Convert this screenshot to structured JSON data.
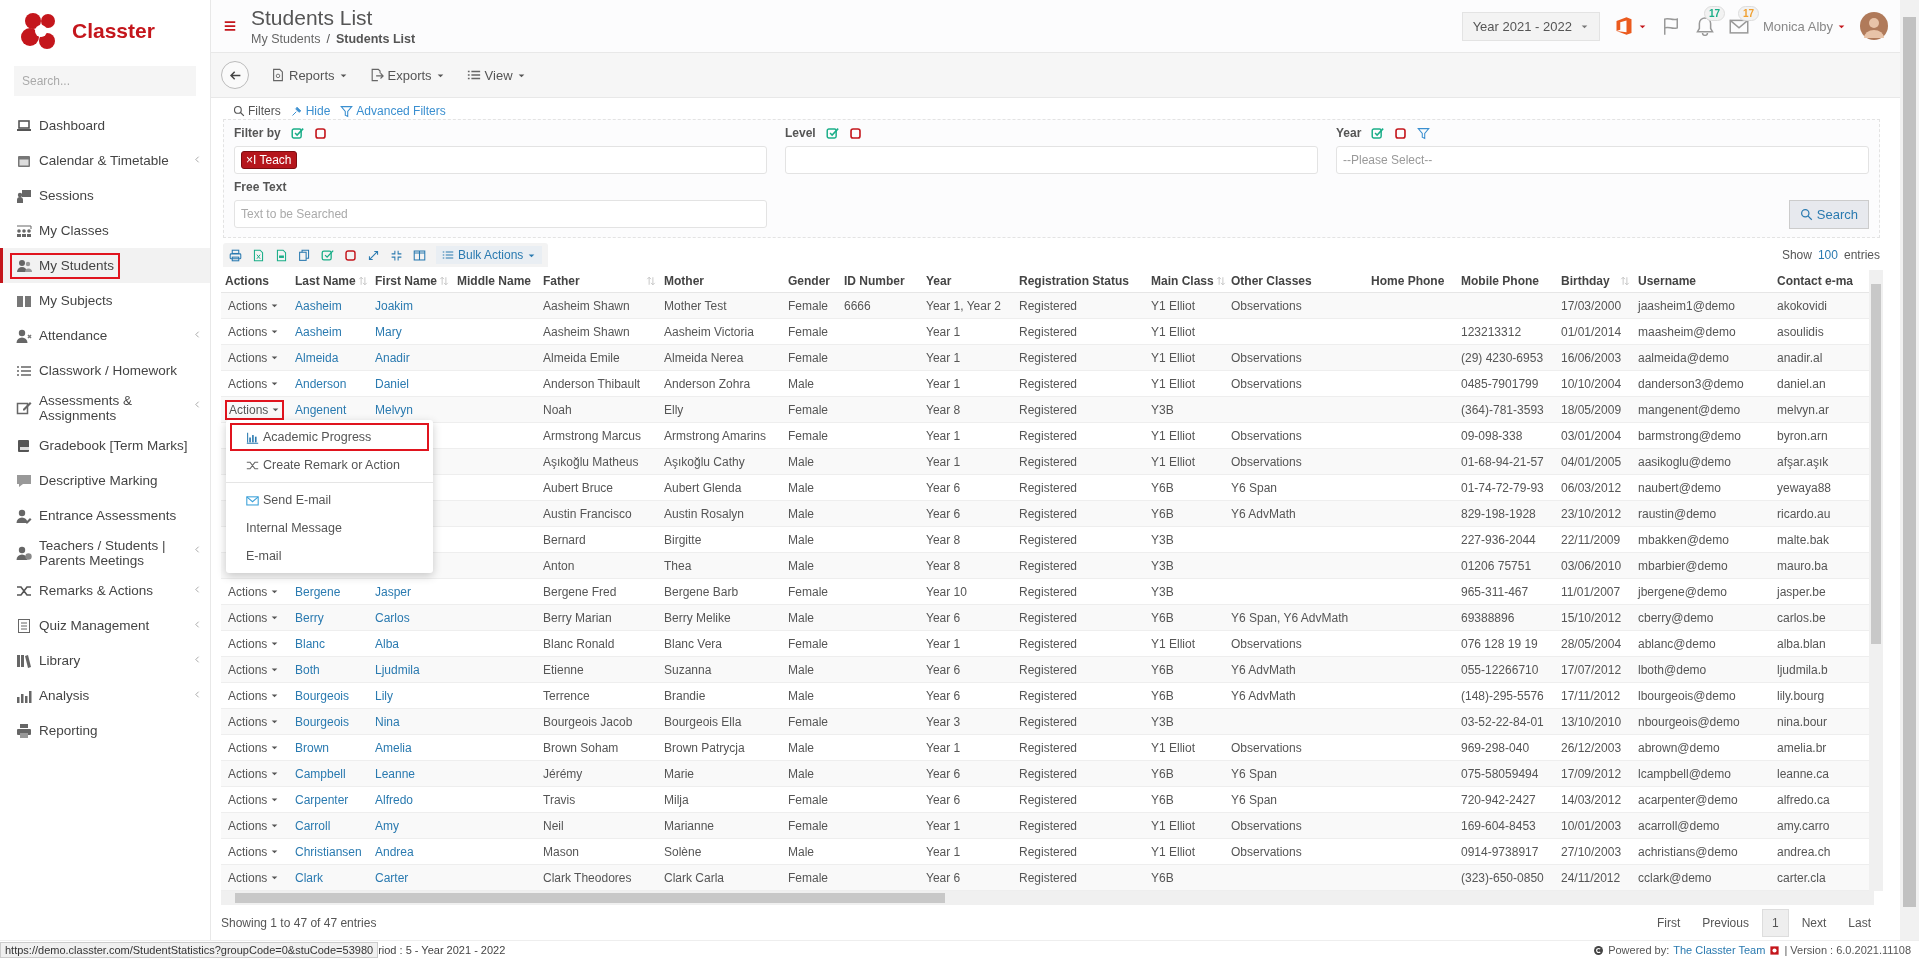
{
  "app": {
    "logo_text": "Classter"
  },
  "sidebar": {
    "search_placeholder": "Search...",
    "items": [
      {
        "label": "Dashboard",
        "selected": false,
        "outlined": false,
        "expandable": false
      },
      {
        "label": "Calendar & Timetable",
        "selected": false,
        "outlined": false,
        "expandable": true
      },
      {
        "label": "Sessions",
        "selected": false,
        "outlined": false,
        "expandable": false
      },
      {
        "label": "My Classes",
        "selected": false,
        "outlined": false,
        "expandable": false
      },
      {
        "label": "My Students",
        "selected": true,
        "outlined": true,
        "expandable": false
      },
      {
        "label": "My Subjects",
        "selected": false,
        "outlined": false,
        "expandable": false
      },
      {
        "label": "Attendance",
        "selected": false,
        "outlined": false,
        "expandable": true
      },
      {
        "label": "Classwork / Homework",
        "selected": false,
        "outlined": false,
        "expandable": false
      },
      {
        "label": "Assessments & Assignments",
        "selected": false,
        "outlined": false,
        "expandable": true
      },
      {
        "label": "Gradebook [Term Marks]",
        "selected": false,
        "outlined": false,
        "expandable": false
      },
      {
        "label": "Descriptive Marking",
        "selected": false,
        "outlined": false,
        "expandable": false
      },
      {
        "label": "Entrance Assessments",
        "selected": false,
        "outlined": false,
        "expandable": false
      },
      {
        "label": "Teachers / Students | Parents Meetings",
        "selected": false,
        "outlined": false,
        "expandable": true
      },
      {
        "label": "Remarks & Actions",
        "selected": false,
        "outlined": false,
        "expandable": true
      },
      {
        "label": "Quiz Management",
        "selected": false,
        "outlined": false,
        "expandable": true
      },
      {
        "label": "Library",
        "selected": false,
        "outlined": false,
        "expandable": true
      },
      {
        "label": "Analysis",
        "selected": false,
        "outlined": false,
        "expandable": true
      },
      {
        "label": "Reporting",
        "selected": false,
        "outlined": false,
        "expandable": false
      }
    ]
  },
  "header": {
    "title": "Students List",
    "breadcrumb": [
      {
        "label": "My Students",
        "current": false
      },
      {
        "label": "Students List",
        "current": true
      }
    ],
    "separator": "/",
    "year_select": "Year 2021 - 2022",
    "badges": [
      {
        "count": "17",
        "color": "#1aae88"
      },
      {
        "count": "17",
        "color": "#f0a030"
      }
    ],
    "user": "Monica Alby"
  },
  "toolbar": {
    "menus": [
      "Reports",
      "Exports",
      "View"
    ]
  },
  "filters": {
    "title": "Filters",
    "hide": "Hide",
    "advanced": "Advanced Filters",
    "filter_by": {
      "label": "Filter by",
      "tags": [
        {
          "remove": "×",
          "label": "I Teach"
        }
      ]
    },
    "level": {
      "label": "Level"
    },
    "year": {
      "label": "Year",
      "placeholder": "--Please Select--"
    },
    "free_text": {
      "label": "Free Text",
      "placeholder": "Text to be Searched"
    },
    "search_button": "Search"
  },
  "table_tools": {
    "bulk_actions": "Bulk Actions",
    "show_label": "Show",
    "page_size": "100",
    "entries_label": "entries"
  },
  "table": {
    "actions_column": {
      "label": "Actions"
    },
    "columns": [
      {
        "label": "Last Name",
        "kind": "link",
        "sortable": true
      },
      {
        "label": "First Name",
        "kind": "link",
        "sortable": true
      },
      {
        "label": "Middle Name",
        "sortable": false
      },
      {
        "label": "Father",
        "kind": "text",
        "sortable": true
      },
      {
        "label": "Mother",
        "kind": "text",
        "sortable": false
      },
      {
        "label": "Gender",
        "kind": "text",
        "sortable": false
      },
      {
        "label": "ID Number",
        "kind": "text",
        "sortable": false
      },
      {
        "label": "Year",
        "kind": "text",
        "sortable": false
      },
      {
        "label": "Registration Status",
        "kind": "text",
        "sortable": false
      },
      {
        "label": "Main Class",
        "kind": "text",
        "sortable": true
      },
      {
        "label": "Other Classes",
        "kind": "text",
        "sortable": false
      },
      {
        "label": "Home Phone",
        "sortable": false
      },
      {
        "label": "Mobile Phone",
        "kind": "text",
        "sortable": false
      },
      {
        "label": "Birthday",
        "kind": "text",
        "sortable": true
      },
      {
        "label": "Username",
        "kind": "text",
        "sortable": false
      },
      {
        "label": "Contact e-ma",
        "kind": "text",
        "sortable": false
      }
    ],
    "rows": [
      {
        "actions": {
          "label": "Actions",
          "outlined": false
        },
        "cells": [
          "Aasheim",
          "Joakim",
          null,
          "Aasheim Shawn",
          "Mother Test",
          "Female",
          "6666",
          "Year 1, Year 2",
          "Registered",
          "Y1 Elliot",
          "Observations",
          null,
          null,
          "17/03/2000",
          "jaasheim1@demo",
          "akokovidi"
        ]
      },
      {
        "actions": {
          "label": "Actions",
          "outlined": false
        },
        "cells": [
          "Aasheim",
          "Mary",
          null,
          "Aasheim Shawn",
          "Aasheim Victoria",
          "Female",
          null,
          "Year 1",
          "Registered",
          "Y1 Elliot",
          null,
          null,
          "123213312",
          "01/01/2014",
          "maasheim@demo",
          "asoulidis"
        ]
      },
      {
        "actions": {
          "label": "Actions",
          "outlined": false
        },
        "cells": [
          "Almeida",
          "Anadir",
          null,
          "Almeida Emile",
          "Almeida Nerea",
          "Female",
          null,
          "Year 1",
          "Registered",
          "Y1 Elliot",
          "Observations",
          null,
          "(29) 4230-6953",
          "16/06/2003",
          "aalmeida@demo",
          "anadir.al"
        ]
      },
      {
        "actions": {
          "label": "Actions",
          "outlined": false
        },
        "cells": [
          "Anderson",
          "Daniel",
          null,
          "Anderson Thibault",
          "Anderson Zohra",
          "Male",
          null,
          "Year 1",
          "Registered",
          "Y1 Elliot",
          "Observations",
          null,
          "0485-7901799",
          "10/10/2004",
          "danderson3@demo",
          "daniel.an"
        ]
      },
      {
        "actions": {
          "label": "Actions",
          "outlined": true
        },
        "cells": [
          "Angenent",
          "Melvyn",
          null,
          "Noah",
          "Elly",
          "Female",
          null,
          "Year 8",
          "Registered",
          "Y3B",
          null,
          null,
          "(364)-781-3593",
          "18/05/2009",
          "mangenent@demo",
          "melvyn.ar"
        ]
      },
      {
        "cells": [
          null,
          null,
          null,
          "Armstrong Marcus",
          "Armstrong Amarins",
          "Female",
          null,
          "Year 1",
          "Registered",
          "Y1 Elliot",
          "Observations",
          null,
          "09-098-338",
          "03/01/2004",
          "barmstrong@demo",
          "byron.arn"
        ]
      },
      {
        "cells": [
          null,
          null,
          null,
          "Aşıkoğlu Matheus",
          "Aşıkoğlu Cathy",
          "Male",
          null,
          "Year 1",
          "Registered",
          "Y1 Elliot",
          "Observations",
          null,
          "01-68-94-21-57",
          "04/01/2005",
          "aasikoglu@demo",
          "afşar.aşık"
        ]
      },
      {
        "cells": [
          null,
          null,
          null,
          "Aubert Bruce",
          "Aubert Glenda",
          "Male",
          null,
          "Year 6",
          "Registered",
          "Y6B",
          "Y6 Span",
          null,
          "01-74-72-79-93",
          "06/03/2012",
          "naubert@demo",
          "yewaya88"
        ]
      },
      {
        "cells": [
          null,
          null,
          null,
          "Austin Francisco",
          "Austin Rosalyn",
          "Male",
          null,
          "Year 6",
          "Registered",
          "Y6B",
          "Y6 AdvMath",
          null,
          "829-198-1928",
          "23/10/2012",
          "raustin@demo",
          "ricardo.au"
        ]
      },
      {
        "cells": [
          null,
          null,
          null,
          "Bernard",
          "Birgitte",
          "Male",
          null,
          "Year 8",
          "Registered",
          "Y3B",
          null,
          null,
          "227-936-2044",
          "22/11/2009",
          "mbakken@demo",
          "malte.bak"
        ]
      },
      {
        "cells": [
          null,
          null,
          null,
          "Anton",
          "Thea",
          "Male",
          null,
          "Year 8",
          "Registered",
          "Y3B",
          null,
          null,
          "01206 75751",
          "03/06/2010",
          "mbarbier@demo",
          "mauro.ba"
        ]
      },
      {
        "actions": {
          "label": "Actions",
          "outlined": false
        },
        "cells": [
          "Bergene",
          "Jasper",
          null,
          "Bergene Fred",
          "Bergene Barb",
          "Female",
          null,
          "Year 10",
          "Registered",
          "Y3B",
          null,
          null,
          "965-311-467",
          "11/01/2007",
          "jbergene@demo",
          "jasper.be"
        ]
      },
      {
        "actions": {
          "label": "Actions",
          "outlined": false
        },
        "cells": [
          "Berry",
          "Carlos",
          null,
          "Berry Marian",
          "Berry Melike",
          "Male",
          null,
          "Year 6",
          "Registered",
          "Y6B",
          "Y6 Span, Y6 AdvMath",
          null,
          "69388896",
          "15/10/2012",
          "cberry@demo",
          "carlos.be"
        ]
      },
      {
        "actions": {
          "label": "Actions",
          "outlined": false
        },
        "cells": [
          "Blanc",
          "Alba",
          null,
          "Blanc Ronald",
          "Blanc Vera",
          "Female",
          null,
          "Year 1",
          "Registered",
          "Y1 Elliot",
          "Observations",
          null,
          "076 128 19 19",
          "28/05/2004",
          "ablanc@demo",
          "alba.blan"
        ]
      },
      {
        "actions": {
          "label": "Actions",
          "outlined": false
        },
        "cells": [
          "Both",
          "Ljudmila",
          null,
          "Etienne",
          "Suzanna",
          "Male",
          null,
          "Year 6",
          "Registered",
          "Y6B",
          "Y6 AdvMath",
          null,
          "055-12266710",
          "17/07/2012",
          "lboth@demo",
          "ljudmila.b"
        ]
      },
      {
        "actions": {
          "label": "Actions",
          "outlined": false
        },
        "cells": [
          "Bourgeois",
          "Lily",
          null,
          "Terrence",
          "Brandie",
          "Male",
          null,
          "Year 6",
          "Registered",
          "Y6B",
          "Y6 AdvMath",
          null,
          "(148)-295-5576",
          "17/11/2012",
          "lbourgeois@demo",
          "lily.bourg"
        ]
      },
      {
        "actions": {
          "label": "Actions",
          "outlined": false
        },
        "cells": [
          "Bourgeois",
          "Nina",
          null,
          "Bourgeois Jacob",
          "Bourgeois Ella",
          "Female",
          null,
          "Year 3",
          "Registered",
          "Y3B",
          null,
          null,
          "03-52-22-84-01",
          "13/10/2010",
          "nbourgeois@demo",
          "nina.bour"
        ]
      },
      {
        "actions": {
          "label": "Actions",
          "outlined": false
        },
        "cells": [
          "Brown",
          "Amelia",
          null,
          "Brown Soham",
          "Brown Patrycja",
          "Male",
          null,
          "Year 1",
          "Registered",
          "Y1 Elliot",
          "Observations",
          null,
          "969-298-040",
          "26/12/2003",
          "abrown@demo",
          "amelia.br"
        ]
      },
      {
        "actions": {
          "label": "Actions",
          "outlined": false
        },
        "cells": [
          "Campbell",
          "Leanne",
          null,
          "Jérémy",
          "Marie",
          "Male",
          null,
          "Year 6",
          "Registered",
          "Y6B",
          "Y6 Span",
          null,
          "075-58059494",
          "17/09/2012",
          "lcampbell@demo",
          "leanne.ca"
        ]
      },
      {
        "actions": {
          "label": "Actions",
          "outlined": false
        },
        "cells": [
          "Carpenter",
          "Alfredo",
          null,
          "Travis",
          "Milja",
          "Female",
          null,
          "Year 6",
          "Registered",
          "Y6B",
          "Y6 Span",
          null,
          "720-942-2427",
          "14/03/2012",
          "acarpenter@demo",
          "alfredo.ca"
        ]
      },
      {
        "actions": {
          "label": "Actions",
          "outlined": false
        },
        "cells": [
          "Carroll",
          "Amy",
          null,
          "Neil",
          "Marianne",
          "Female",
          null,
          "Year 1",
          "Registered",
          "Y1 Elliot",
          "Observations",
          null,
          "169-604-8453",
          "10/01/2003",
          "acarroll@demo",
          "amy.carro"
        ]
      },
      {
        "actions": {
          "label": "Actions",
          "outlined": false
        },
        "cells": [
          "Christiansen",
          "Andrea",
          null,
          "Mason",
          "Solène",
          "Male",
          null,
          "Year 1",
          "Registered",
          "Y1 Elliot",
          "Observations",
          null,
          "0914-9738917",
          "27/10/2003",
          "achristians@demo",
          "andrea.ch"
        ]
      },
      {
        "actions": {
          "label": "Actions",
          "outlined": false
        },
        "cells": [
          "Clark",
          "Carter",
          null,
          "Clark Theodores",
          "Clark Carla",
          "Female",
          null,
          "Year 6",
          "Registered",
          "Y6B",
          null,
          null,
          "(323)-650-0850",
          "24/11/2012",
          "cclark@demo",
          "carter.cla"
        ]
      }
    ]
  },
  "actions_menu": {
    "groups": [
      [
        {
          "label": "Academic Progress",
          "outlined": true
        },
        {
          "label": "Create Remark or Action",
          "outlined": false
        }
      ],
      [
        {
          "label": "Send E-mail",
          "outlined": false
        },
        {
          "label": "Internal Message",
          "outlined": false
        },
        {
          "label": "E-mail",
          "outlined": false
        }
      ]
    ]
  },
  "footer": {
    "info": "Showing 1 to 47 of 47 entries",
    "pagination": [
      {
        "label": "First",
        "selected": false
      },
      {
        "label": "Previous",
        "selected": false
      },
      {
        "label": "1",
        "selected": true
      },
      {
        "label": "Next",
        "selected": false
      },
      {
        "label": "Last",
        "selected": false
      }
    ]
  },
  "status_bar": {
    "link_preview": "https://demo.classter.com/StudentStatistics?groupCode=0&stuCode=53980",
    "period": "riod : 5 - Year 2021 - 2022",
    "powered_by": "Powered by:",
    "team": "The Classter Team",
    "version": "| Version : 6.0.2021.11108"
  }
}
